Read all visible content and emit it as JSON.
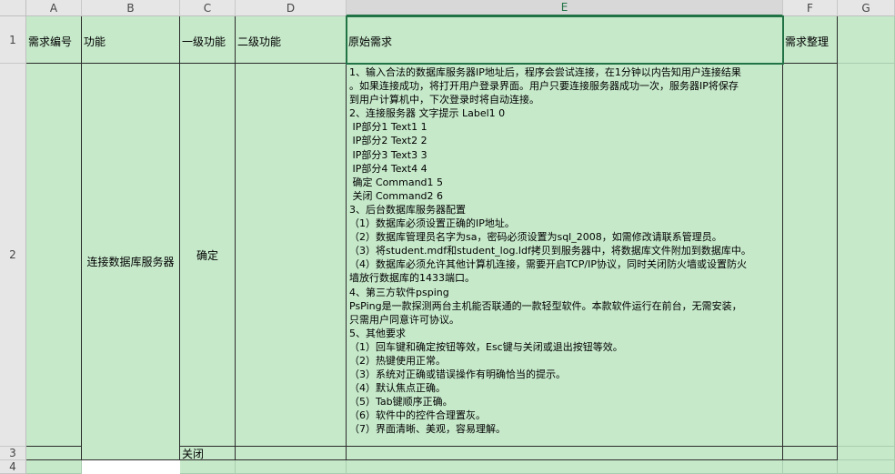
{
  "columns": [
    "A",
    "B",
    "C",
    "D",
    "E",
    "F",
    "G"
  ],
  "rows": [
    "1",
    "2",
    "3",
    "4"
  ],
  "header_row": {
    "a": "需求编号",
    "b": "功能",
    "c": "一级功能",
    "d": "二级功能",
    "e": "原始需求",
    "f": "需求整理"
  },
  "row2": {
    "b": "连接数据库服务器",
    "c": "确定"
  },
  "row3": {
    "c": "关闭"
  },
  "requirement_lines": [
    "1、输入合法的数据库服务器IP地址后，程序会尝试连接，在1分钟以内告知用户连接结果",
    "。如果连接成功，将打开用户登录界面。用户只要连接服务器成功一次，服务器IP将保存",
    "到用户计算机中，下次登录时将自动连接。",
    "2、连接服务器 文字提示 Label1 0",
    " IP部分1 Text1 1",
    " IP部分2 Text2 2",
    " IP部分3 Text3 3",
    " IP部分4 Text4 4",
    " 确定 Command1 5",
    " 关闭 Command2 6",
    "3、后台数据库服务器配置",
    "（1）数据库必须设置正确的IP地址。",
    "（2）数据库管理员名字为sa，密码必须设置为sql_2008，如需修改请联系管理员。",
    "（3）将student.mdf和student_log.ldf拷贝到服务器中，将数据库文件附加到数据库中。",
    "（4）数据库必须允许其他计算机连接，需要开启TCP/IP协议，同时关闭防火墙或设置防火",
    "墙放行数据库的1433端口。",
    "4、第三方软件psping",
    "PsPing是一款探测两台主机能否联通的一款轻型软件。本款软件运行在前台，无需安装，",
    "只需用户同意许可协议。",
    "5、其他要求",
    "（1）回车键和确定按钮等效，Esc键与关闭或退出按钮等效。",
    "（2）热键使用正常。",
    "（3）系统对正确或错误操作有明确恰当的提示。",
    "（4）默认焦点正确。",
    "（5）Tab键顺序正确。",
    "（6）软件中的控件合理置灰。",
    "（7）界面清晰、美观，容易理解。"
  ],
  "colors": {
    "cell_fill": "#c6e9ca",
    "header_fill": "#e6e6e6",
    "selection": "#217346"
  }
}
